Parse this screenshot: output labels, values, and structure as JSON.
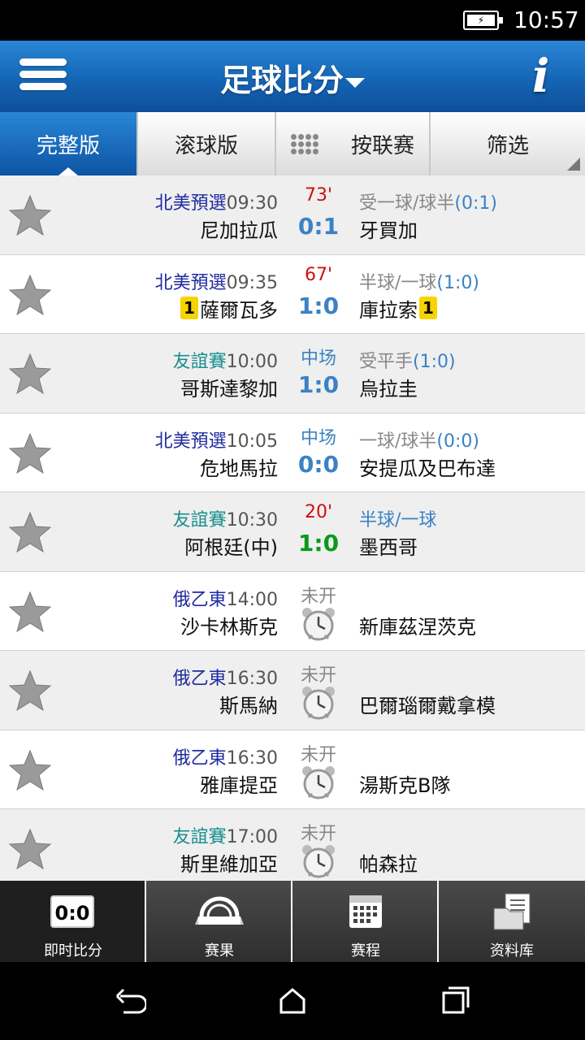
{
  "status_bar": {
    "time": "10:57",
    "battery": "⚡"
  },
  "header": {
    "title": "足球比分",
    "menu_icon": "hamburger-icon",
    "info_icon": "info-icon"
  },
  "tabs": [
    {
      "label": "完整版",
      "active": true
    },
    {
      "label": "滚球版",
      "active": false
    },
    {
      "label": "按联赛",
      "active": false
    },
    {
      "label": "筛选",
      "active": false
    }
  ],
  "matches": [
    {
      "league": "北美預選",
      "league_color": "#1f2aa0",
      "time": "09:30",
      "status": "73'",
      "status_type": "red",
      "odds_text": "受一球/球半",
      "odds_value": "(0:1)",
      "home": "尼加拉瓜",
      "score": "0:1",
      "away": "牙買加"
    },
    {
      "league": "北美預選",
      "league_color": "#1f2aa0",
      "time": "09:35",
      "status": "67'",
      "status_type": "red",
      "odds_text": "半球/一球",
      "odds_value": "(1:0)",
      "home": "薩爾瓦多",
      "home_card": "1",
      "score": "1:0",
      "away": "庫拉索",
      "away_card": "1"
    },
    {
      "league": "友誼賽",
      "league_color": "#1a8f8f",
      "time": "10:00",
      "status": "中场",
      "status_type": "blue",
      "odds_text": "受平手",
      "odds_value": "(1:0)",
      "home": "哥斯達黎加",
      "score": "1:0",
      "away": "烏拉圭"
    },
    {
      "league": "北美預選",
      "league_color": "#1f2aa0",
      "time": "10:05",
      "status": "中场",
      "status_type": "blue",
      "odds_text": "一球/球半",
      "odds_value": "(0:0)",
      "home": "危地馬拉",
      "score": "0:0",
      "away": "安提瓜及巴布達"
    },
    {
      "league": "友誼賽",
      "league_color": "#1a8f8f",
      "time": "10:30",
      "status": "20'",
      "status_type": "red",
      "odds_text": "半球/一球",
      "odds_value": "",
      "odds_blue": true,
      "home": "阿根廷(中)",
      "score": "1:0",
      "score_green": true,
      "away": "墨西哥"
    },
    {
      "league": "俄乙東",
      "league_color": "#1f2aa0",
      "time": "14:00",
      "status": "未开",
      "status_type": "gray",
      "home": "沙卡林斯克",
      "score": "",
      "away": "新庫茲涅茨克"
    },
    {
      "league": "俄乙東",
      "league_color": "#1f2aa0",
      "time": "16:30",
      "status": "未开",
      "status_type": "gray",
      "home": "斯馬納",
      "score": "",
      "away": "巴爾瑙爾戴拿模"
    },
    {
      "league": "俄乙東",
      "league_color": "#1f2aa0",
      "time": "16:30",
      "status": "未开",
      "status_type": "gray",
      "home": "雅庫提亞",
      "score": "",
      "away": "湯斯克B隊"
    },
    {
      "league": "友誼賽",
      "league_color": "#1a8f8f",
      "time": "17:00",
      "status": "未开",
      "status_type": "gray",
      "home": "斯里維加亞",
      "score": "",
      "away": "帕森拉"
    }
  ],
  "bottom_nav": [
    {
      "label": "即时比分",
      "icon": "score-board-icon",
      "icon_text": "0:0",
      "active": true
    },
    {
      "label": "赛果",
      "icon": "results-icon",
      "active": false
    },
    {
      "label": "赛程",
      "icon": "calendar-icon",
      "active": false
    },
    {
      "label": "资料库",
      "icon": "database-icon",
      "active": false
    }
  ]
}
